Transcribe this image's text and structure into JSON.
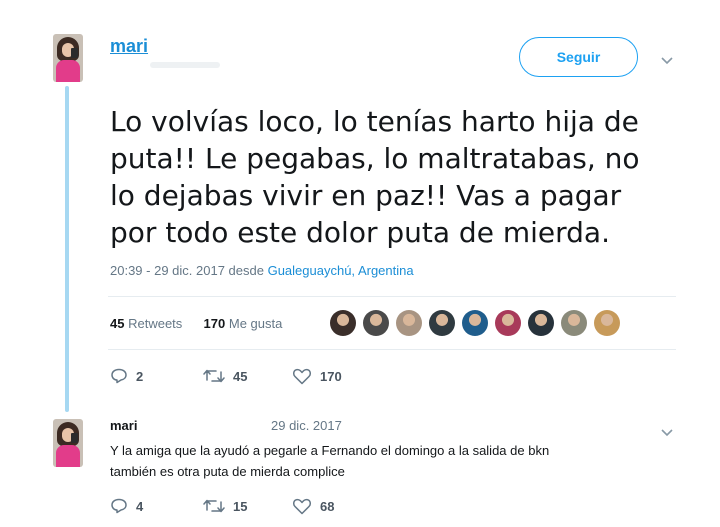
{
  "tweet": {
    "author_name": "mari",
    "follow_label": "Seguir",
    "text": "Lo volvías loco, lo tenías harto hija de puta!! Le pegabas, lo maltratabas, no lo dejabas vivir en paz!! Vas a pagar por todo este dolor puta de mierda.",
    "timestamp": "20:39 - 29 dic. 2017",
    "location_prefix": "desde",
    "location": "Gualeguaychú, Argentina",
    "retweets_count": "45",
    "retweets_label": "Retweets",
    "likes_count": "170",
    "likes_label": "Me gusta",
    "actions": {
      "reply_count": "2",
      "retweet_count": "45",
      "like_count": "170"
    }
  },
  "likers": [
    {
      "icon": "liker-avatar-1",
      "color": "#3a2e2a"
    },
    {
      "icon": "liker-avatar-2",
      "color": "#4a4a4a"
    },
    {
      "icon": "liker-avatar-3",
      "color": "#a89482"
    },
    {
      "icon": "liker-avatar-4",
      "color": "#2f3a40"
    },
    {
      "icon": "liker-avatar-5",
      "color": "#1f5d8c"
    },
    {
      "icon": "liker-avatar-6",
      "color": "#a83a5a"
    },
    {
      "icon": "liker-avatar-7",
      "color": "#27323b"
    },
    {
      "icon": "liker-avatar-8",
      "color": "#8a8a7a"
    },
    {
      "icon": "liker-avatar-9",
      "color": "#c79a5a"
    }
  ],
  "reply": {
    "author_name": "mari",
    "date": "29 dic. 2017",
    "text_line1": "Y la amiga que la ayudó a pegarle a Fernando el domingo a la salida de bkn",
    "text_line2": "también es otra puta de mierda complice",
    "actions": {
      "reply_count": "4",
      "retweet_count": "15",
      "like_count": "68"
    }
  },
  "colors": {
    "accent": "#1da1f2",
    "link": "#1b8ed6",
    "thread_line": "#a6d8f2",
    "muted": "#657786"
  }
}
